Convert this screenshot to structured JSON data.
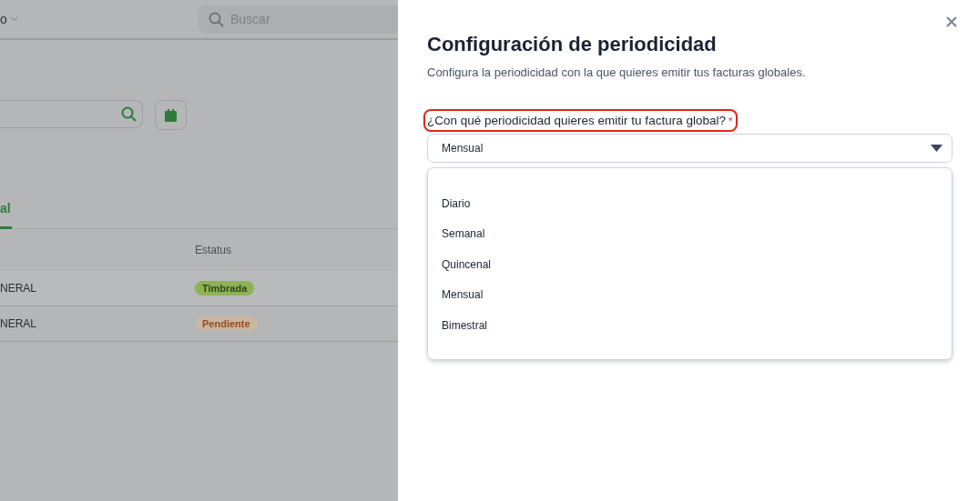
{
  "background": {
    "header": {
      "menu_label": "o",
      "search": {
        "placeholder": "Buscar"
      }
    },
    "tab": {
      "label": "al",
      "selected": true
    },
    "table": {
      "columns": [
        "Estatus"
      ],
      "rows": [
        {
          "column_1": "NERAL",
          "status": {
            "label": "Timbrada",
            "kind": "success"
          }
        },
        {
          "column_1": "NERAL",
          "status": {
            "label": "Pendiente",
            "kind": "pending"
          }
        }
      ]
    }
  },
  "panel": {
    "title": "Configuración de periodicidad",
    "subtitle": "Configura la periodicidad con la que quieres emitir tus facturas globales.",
    "field": {
      "label": "¿Con qué periodicidad quieres emitir tu factura global?",
      "required_mark": "*",
      "highlighted": true,
      "value": "Mensual",
      "expanded": true,
      "options": [
        "Diario",
        "Semanal",
        "Quincenal",
        "Mensual",
        "Bimestral"
      ]
    }
  }
}
